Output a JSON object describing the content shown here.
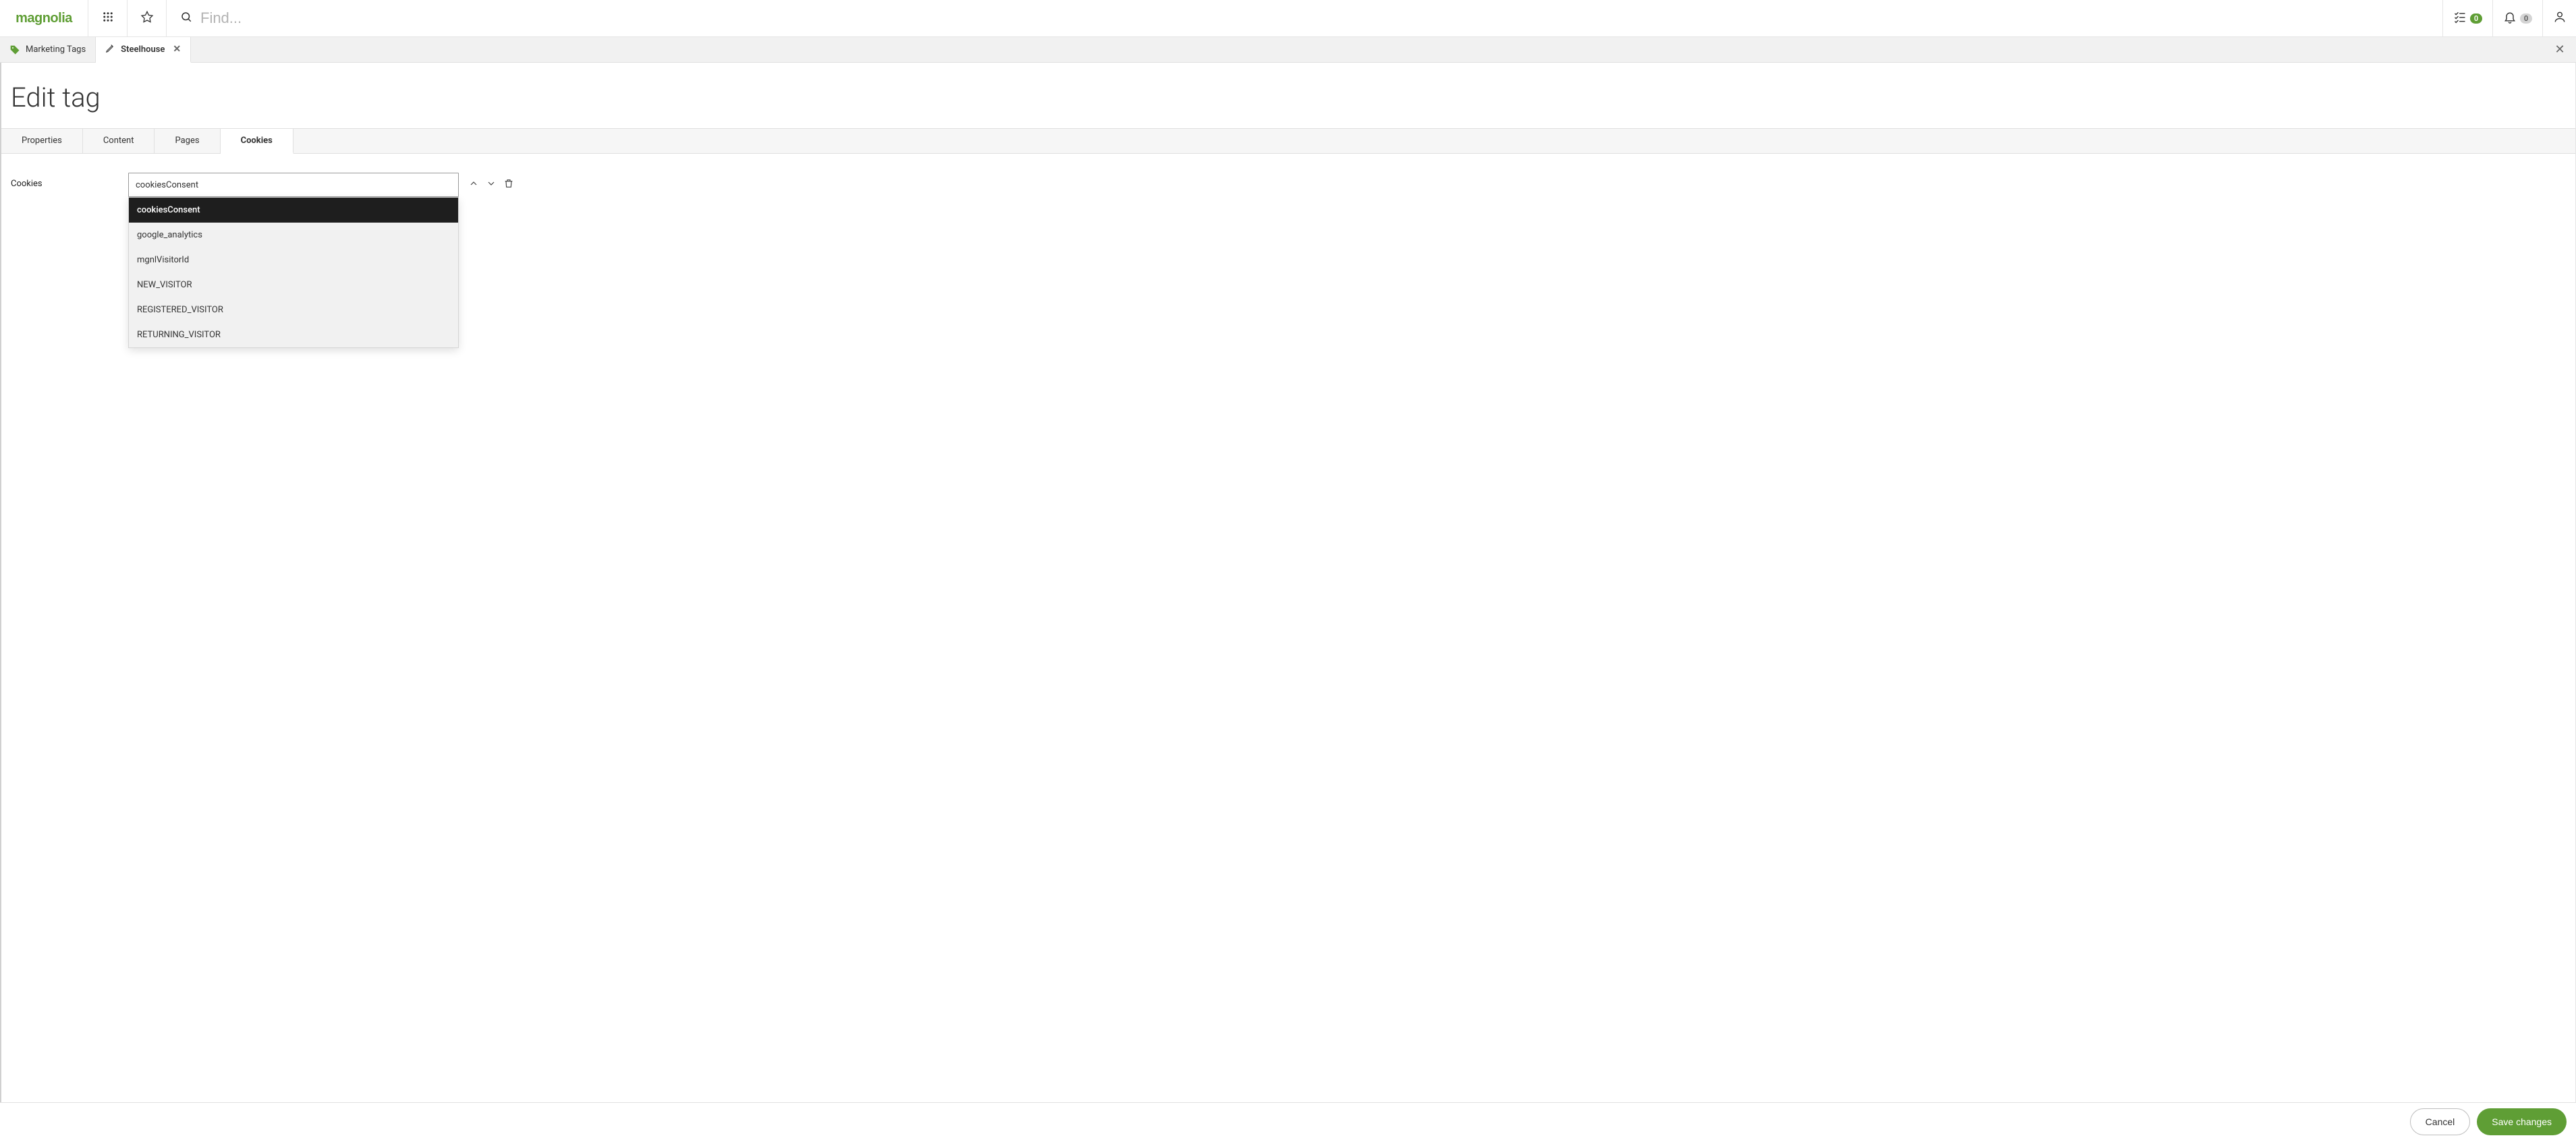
{
  "brand": {
    "name": "magnolia"
  },
  "header": {
    "search_placeholder": "Find...",
    "tasks_count": "0",
    "notifications_count": "0"
  },
  "apptabs": {
    "back_label": "Marketing Tags",
    "active_label": "Steelhouse"
  },
  "page": {
    "title": "Edit tag"
  },
  "formtabs": [
    "Properties",
    "Content",
    "Pages",
    "Cookies"
  ],
  "formtabs_active_index": 3,
  "form": {
    "cookies_label": "Cookies",
    "combo_value": "cookiesConsent",
    "dropdown_options": [
      "cookiesConsent",
      "google_analytics",
      "mgnlVisitorId",
      "NEW_VISITOR",
      "REGISTERED_VISITOR",
      "RETURNING_VISITOR"
    ],
    "dropdown_selected_index": 0
  },
  "footer": {
    "cancel": "Cancel",
    "save": "Save changes"
  }
}
